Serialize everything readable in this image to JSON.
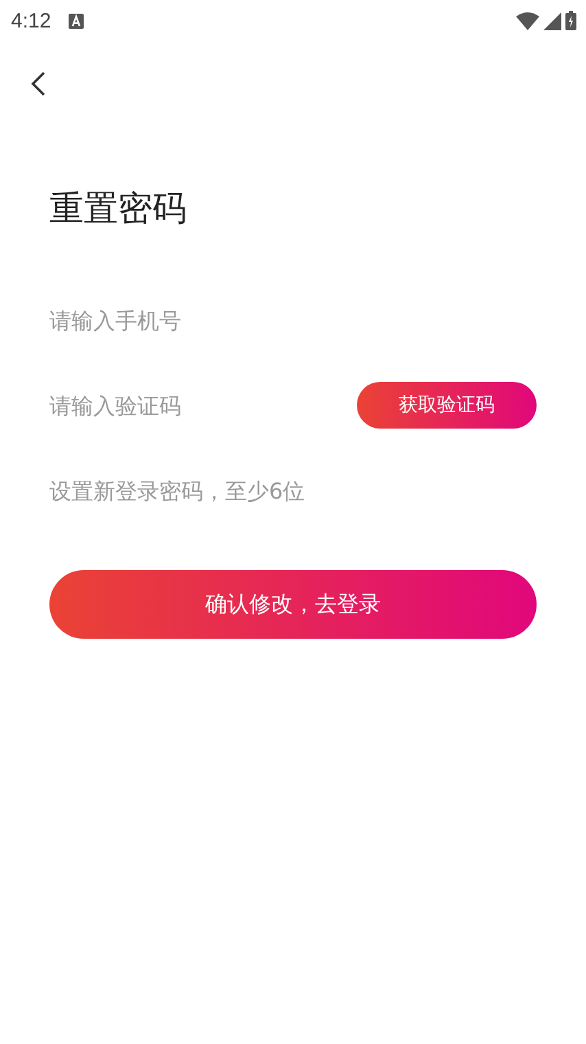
{
  "status_bar": {
    "time": "4:12"
  },
  "title": "重置密码",
  "fields": [
    {
      "kind": "text",
      "placeholder": "请输入手机号"
    },
    {
      "kind": "code",
      "placeholder": "请输入验证码",
      "button": "获取验证码"
    },
    {
      "kind": "password",
      "placeholder": "设置新登录密码，至少6位"
    }
  ],
  "submit_button": "确认修改，去登录"
}
